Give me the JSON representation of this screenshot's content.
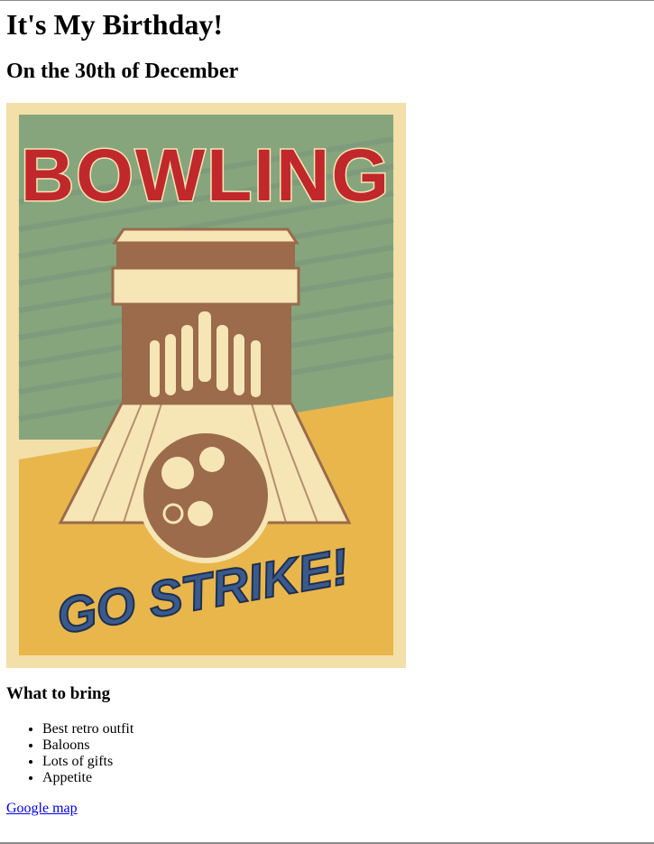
{
  "page": {
    "title": "It's My Birthday!",
    "subtitle": "On the 30th of December"
  },
  "poster": {
    "headline": "BOWLING",
    "tagline": "GO STRIKE!",
    "colors": {
      "frame": "#f3dfa8",
      "green": "#86a57d",
      "yellow": "#e9b64c",
      "red": "#c0282b",
      "brown": "#9b6b4b",
      "cream": "#f6e5b5",
      "blue": "#3a5a8c"
    }
  },
  "bring": {
    "heading": "What to bring",
    "items": [
      "Best retro outfit",
      "Baloons",
      "Lots of gifts",
      "Appetite"
    ]
  },
  "map_link": {
    "label": "Google map"
  }
}
